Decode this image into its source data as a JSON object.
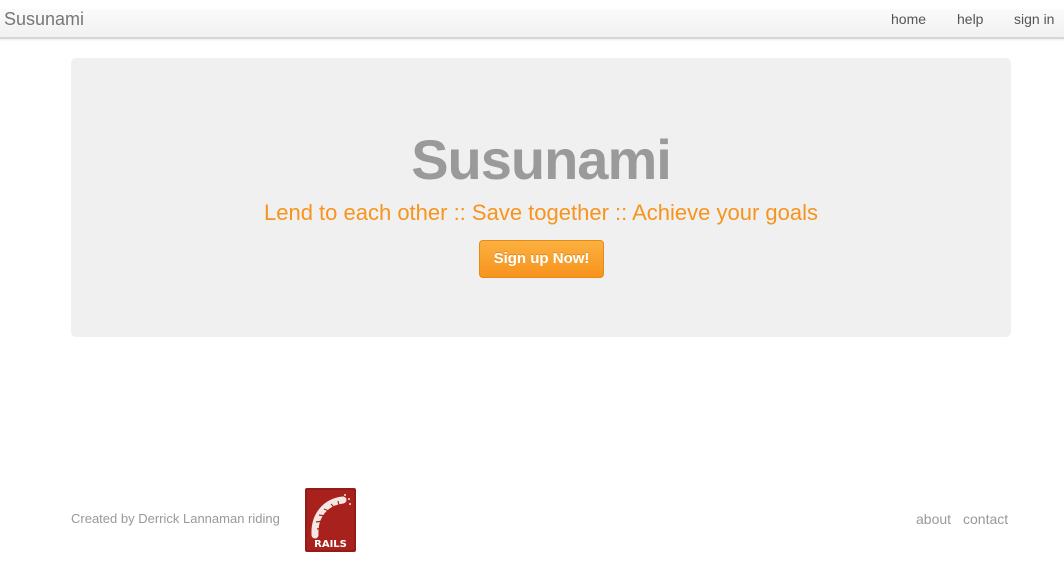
{
  "navbar": {
    "brand": "Susunami",
    "links": [
      "home",
      "help",
      "sign in"
    ]
  },
  "hero": {
    "title": "Susunami",
    "tagline": "Lend to each other :: Save together :: Achieve your goals",
    "signup_button": "Sign up Now!"
  },
  "footer": {
    "credit": "Created by Derrick Lannaman riding",
    "logo_text": "RAILS",
    "links": [
      "about",
      "contact"
    ]
  },
  "colors": {
    "accent": "#f7941d",
    "hero_background": "#f0f0f0",
    "title_gray": "#9a9a9a",
    "rails_red": "#a8211c"
  }
}
